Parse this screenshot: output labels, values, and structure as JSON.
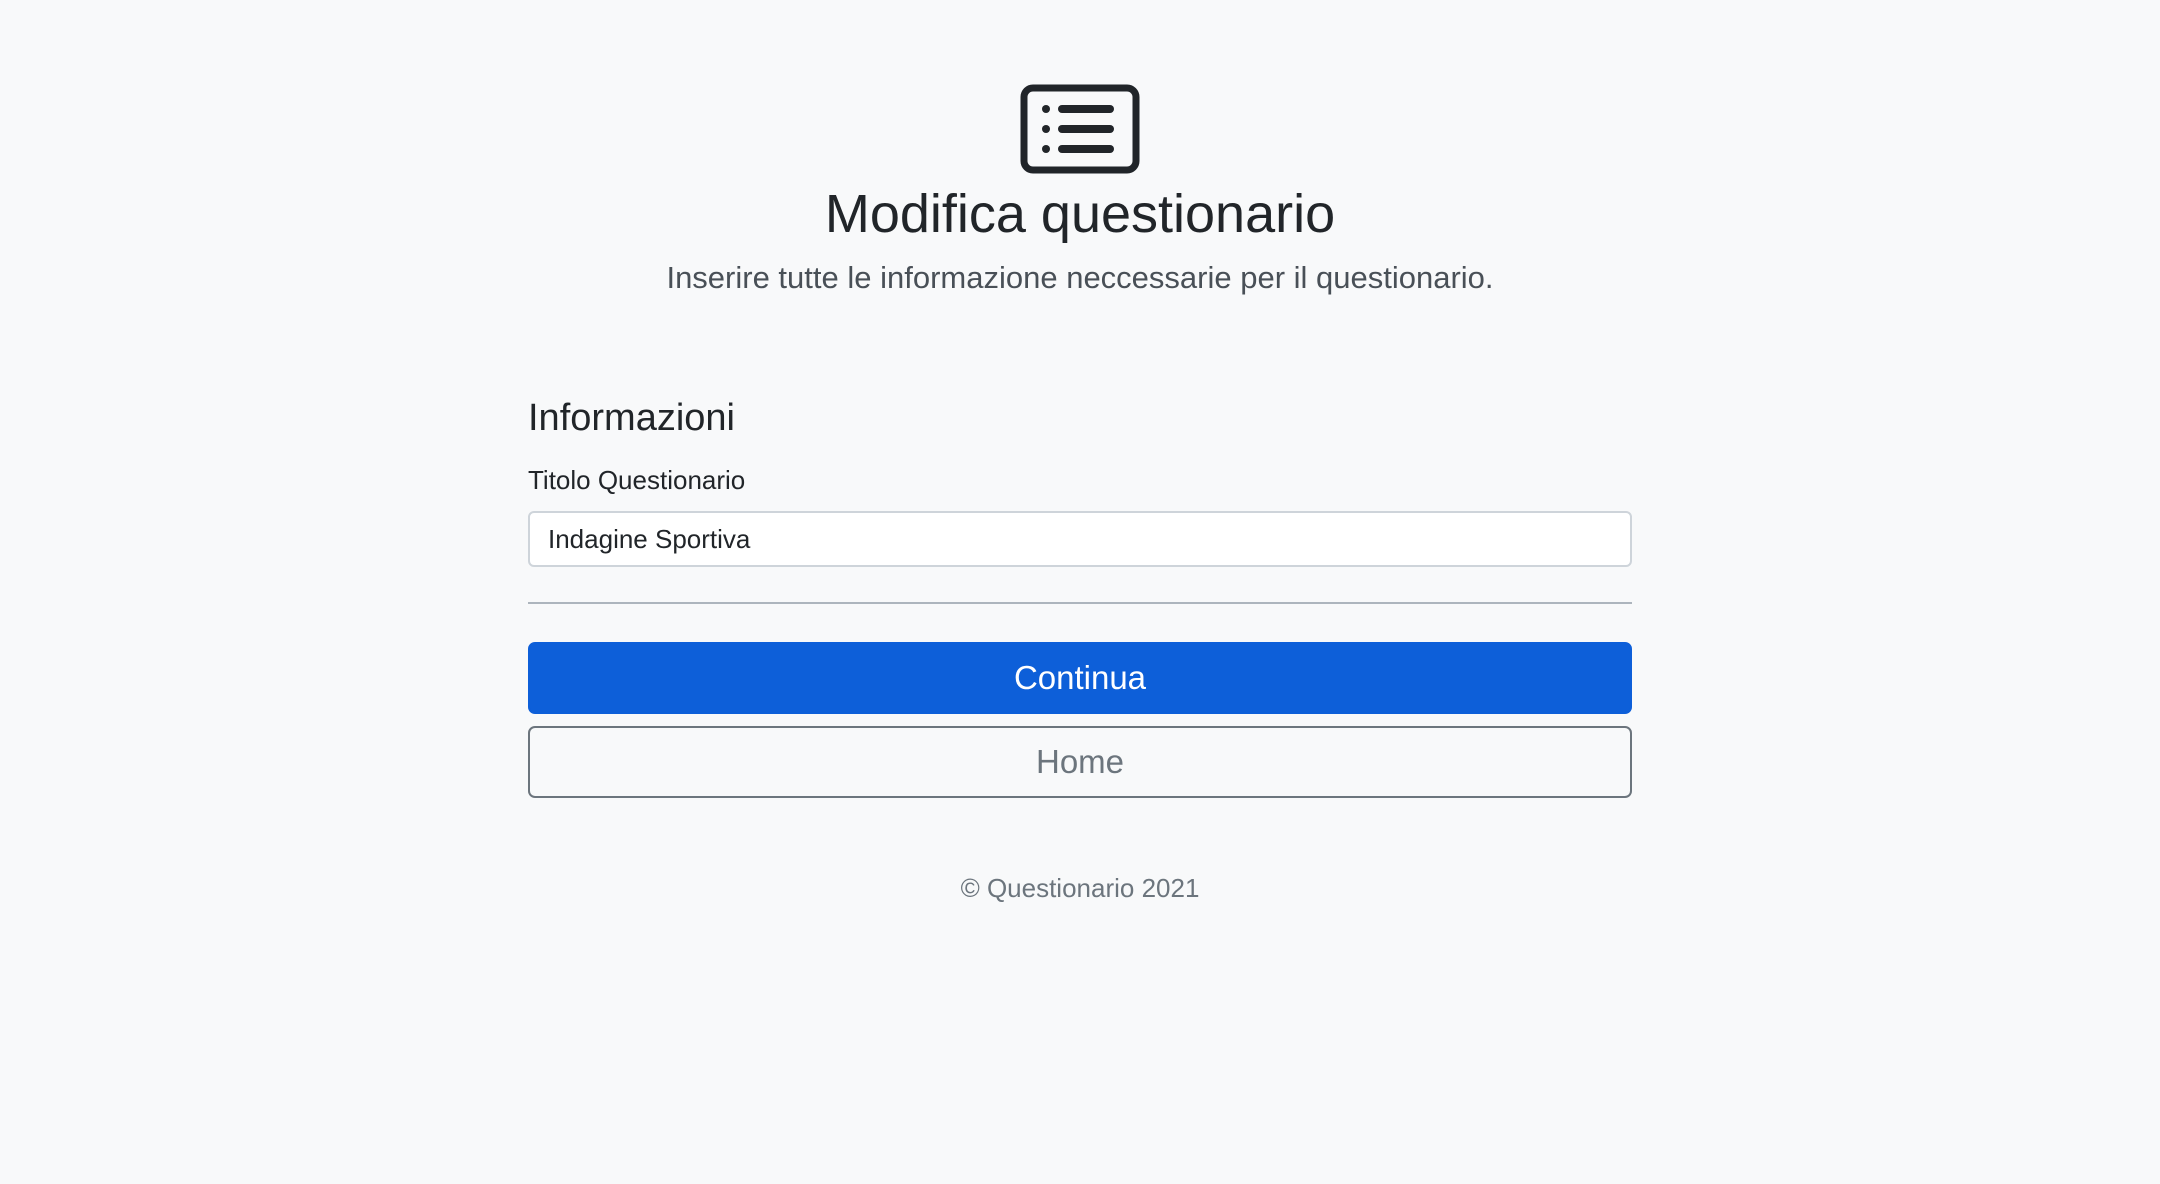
{
  "header": {
    "icon": "list-card-icon",
    "title": "Modifica questionario",
    "subtitle": "Inserire tutte le informazione neccessarie per il questionario."
  },
  "form": {
    "section_title": "Informazioni",
    "title_field": {
      "label": "Titolo Questionario",
      "value": "Indagine Sportiva"
    },
    "continue_label": "Continua",
    "home_label": "Home"
  },
  "footer": {
    "copyright": "© Questionario 2021"
  },
  "colors": {
    "background": "#f8f9fa",
    "primary": "#0d5fd9",
    "secondary": "#6c757d",
    "text": "#212529"
  }
}
